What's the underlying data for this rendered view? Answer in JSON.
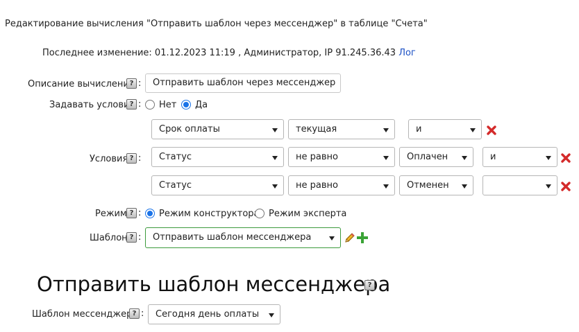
{
  "page": {
    "title": "Редактирование вычисления \"Отправить шаблон через мессенджер\" в таблице \"Счета\"",
    "last_change_label": "Последнее изменение: 01.12.2023 11:19 , Администратор, IP 91.245.36.43",
    "log_link": "Лог"
  },
  "form": {
    "description_label": "Описание вычисления",
    "description_value": "Отправить шаблон через мессенджер",
    "conditions_toggle_label": "Задавать условия",
    "conditions_no": "Нет",
    "conditions_yes": "Да",
    "conditions_selected": "Да",
    "conditions_label": "Условия",
    "conditions": [
      {
        "field": "Срок оплаты",
        "operator": "текущая",
        "value": "",
        "logic": "и"
      },
      {
        "field": "Статус",
        "operator": "не равно",
        "value": "Оплачен",
        "logic": "и"
      },
      {
        "field": "Статус",
        "operator": "не равно",
        "value": "Отменен",
        "logic": ""
      }
    ],
    "mode_label": "Режим",
    "mode_constructor": "Режим конструктора",
    "mode_expert": "Режим эксперта",
    "mode_selected": "Режим конструктора",
    "template_label": "Шаблон",
    "template_value": "Отправить шаблон мессенджера"
  },
  "section": {
    "heading": "Отправить шаблон мессенджера",
    "messenger_template_label": "Шаблон мессенджера",
    "messenger_template_value": "Сегодня день оплаты"
  },
  "colors": {
    "link": "#1a4fc4",
    "delete_icon": "#d42a2a",
    "add_icon": "#3aa336",
    "radio_accent": "#1a73e8",
    "select_focus_border": "#3c9a3c"
  }
}
